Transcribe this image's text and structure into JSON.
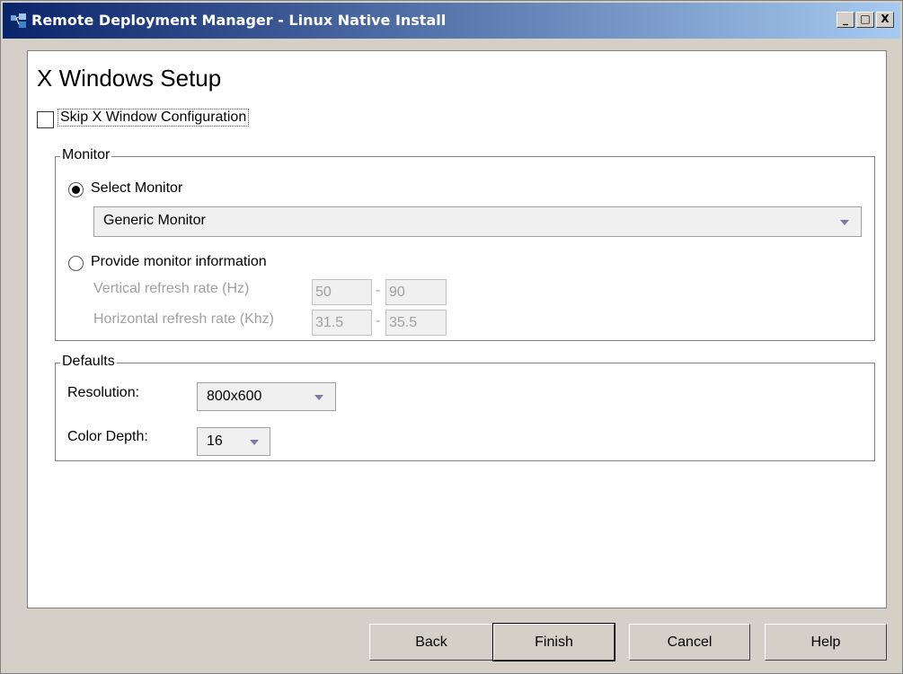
{
  "window": {
    "title": "Remote Deployment Manager - Linux Native Install",
    "controls": {
      "minimize": "_",
      "maximize": "□",
      "close": "X"
    }
  },
  "page": {
    "heading": "X Windows Setup",
    "skip_checkbox": {
      "label": "Skip X Window Configuration",
      "checked": false
    }
  },
  "monitor": {
    "legend": "Monitor",
    "select_option": {
      "label": "Select Monitor",
      "selected": true
    },
    "monitor_combo": {
      "value": "Generic Monitor"
    },
    "provide_option": {
      "label": "Provide monitor information",
      "selected": false
    },
    "vertical": {
      "label": "Vertical refresh rate (Hz)",
      "min": "50",
      "max": "90",
      "sep": "-"
    },
    "horizontal": {
      "label": "Horizontal refresh rate (Khz)",
      "min": "31.5",
      "max": "35.5",
      "sep": "-"
    }
  },
  "defaults": {
    "legend": "Defaults",
    "resolution": {
      "label": "Resolution:",
      "value": "800x600"
    },
    "color_depth": {
      "label": "Color Depth:",
      "value": "16"
    }
  },
  "buttons": {
    "back": "Back",
    "finish": "Finish",
    "cancel": "Cancel",
    "help": "Help"
  },
  "colors": {
    "titlebar_start": "#0a246a",
    "titlebar_end": "#a6caf0",
    "dialog_bg": "#d4d0c8",
    "panel_bg": "#ffffff",
    "disabled_text": "#a0a0a0"
  }
}
